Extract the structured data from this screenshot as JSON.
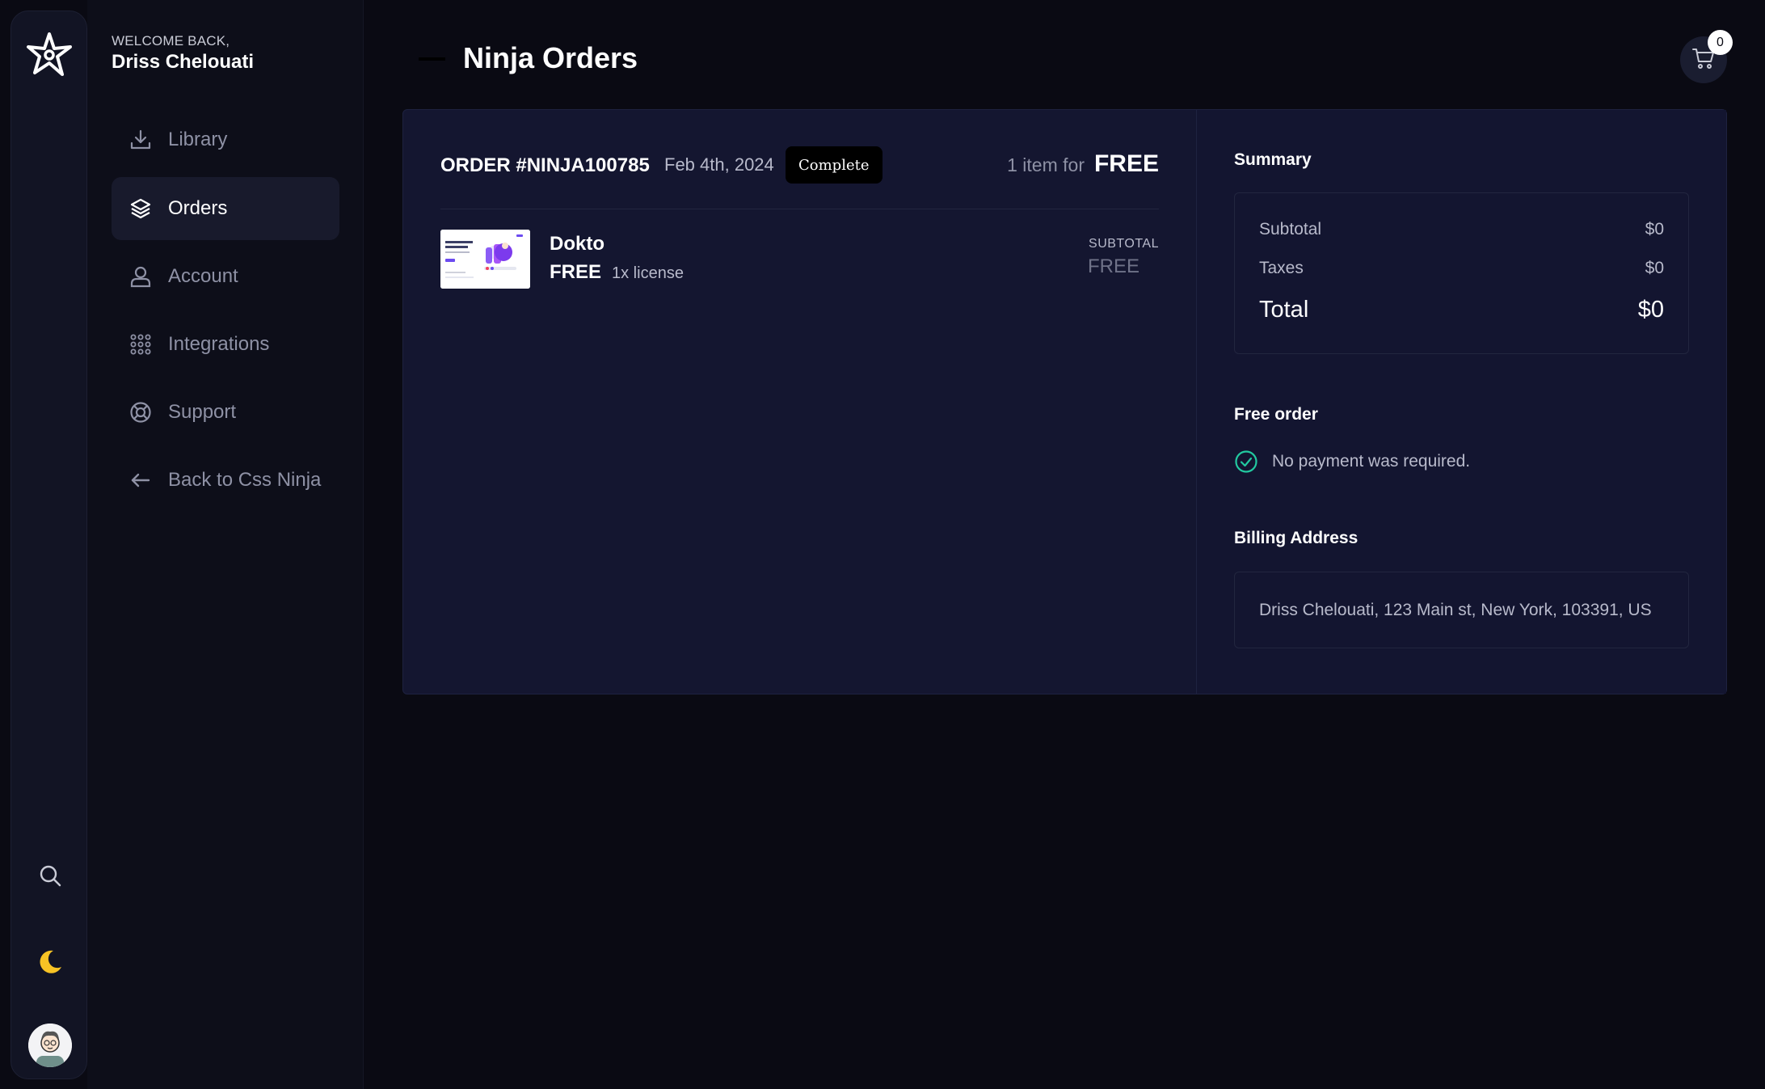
{
  "colors": {
    "background": "#0a0a13",
    "card": "#141630",
    "accent_success": "#22c9a0",
    "moon": "#f7c325"
  },
  "rail": {
    "logo_icon": "ninja-star-icon",
    "search_icon": "search-icon",
    "theme_icon": "moon-icon",
    "avatar_icon": "user-avatar"
  },
  "sidebar": {
    "welcome_label": "WELCOME BACK,",
    "user_name": "Driss Chelouati",
    "items": [
      {
        "label": "Library",
        "icon": "download-icon",
        "active": false
      },
      {
        "label": "Orders",
        "icon": "layers-icon",
        "active": true
      },
      {
        "label": "Account",
        "icon": "user-icon",
        "active": false
      },
      {
        "label": "Integrations",
        "icon": "grid-dots-icon",
        "active": false
      },
      {
        "label": "Support",
        "icon": "lifebuoy-icon",
        "active": false
      },
      {
        "label": "Back to Css Ninja",
        "icon": "arrow-left-icon",
        "active": false
      }
    ]
  },
  "header": {
    "title": "Ninja Orders",
    "cart_icon": "cart-icon",
    "cart_count": "0"
  },
  "order": {
    "id": "ORDER #NINJA100785",
    "date": "Feb 4th, 2024",
    "status": "Complete",
    "items_count_text": "1 item for",
    "total_text": "FREE",
    "product": {
      "name": "Dokto",
      "price": "FREE",
      "license": "1x license",
      "subtotal_label": "SUBTOTAL",
      "subtotal_value": "FREE"
    }
  },
  "summary": {
    "heading": "Summary",
    "subtotal_label": "Subtotal",
    "subtotal_value": "$0",
    "taxes_label": "Taxes",
    "taxes_value": "$0",
    "total_label": "Total",
    "total_value": "$0"
  },
  "free_order": {
    "heading": "Free order",
    "note": "No payment was required.",
    "icon": "check-circle-icon"
  },
  "billing": {
    "heading": "Billing Address",
    "address": "Driss Chelouati, 123 Main st, New York, 103391, US"
  }
}
